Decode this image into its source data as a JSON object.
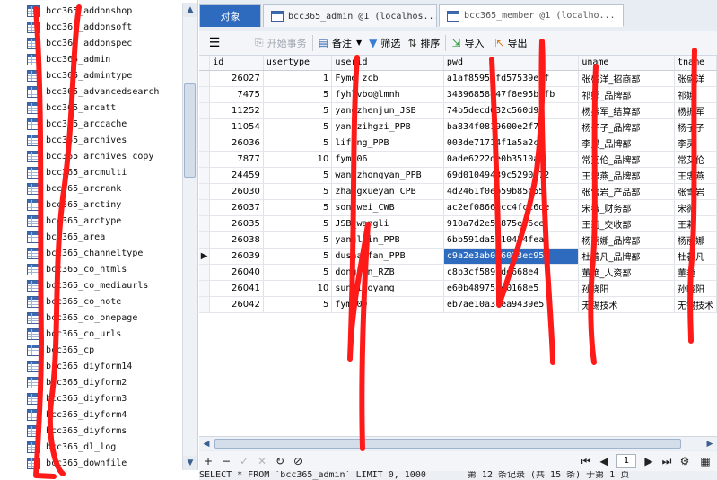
{
  "tree": {
    "items": [
      "bcc365_addonshop",
      "bcc365_addonsoft",
      "bcc365_addonspec",
      "bcc365_admin",
      "bcc365_admintype",
      "bcc365_advancedsearch",
      "bcc365_arcatt",
      "bcc365_arccache",
      "bcc365_archives",
      "bcc365_archives_copy",
      "bcc365_arcmulti",
      "bcc365_arcrank",
      "bcc365_arctiny",
      "bcc365_arctype",
      "bcc365_area",
      "bcc365_channeltype",
      "bcc365_co_htmls",
      "bcc365_co_mediaurls",
      "bcc365_co_note",
      "bcc365_co_onepage",
      "bcc365_co_urls",
      "bcc365_cp",
      "bcc365_diyform14",
      "bcc365_diyform2",
      "bcc365_diyform3",
      "bcc365_diyform4",
      "bcc365_diyforms",
      "bcc365_dl_log",
      "bcc365_downfile"
    ]
  },
  "tabs": {
    "objects": "对象",
    "admin": "bcc365_admin @1 (localhos...",
    "member": "bcc365_member @1 (localho..."
  },
  "toolbar": {
    "menu_icon": "menu-icon",
    "begin_tx": "开始事务",
    "note": "备注",
    "filter": "筛选",
    "sort": "排序",
    "import": "导入",
    "export": "导出"
  },
  "grid": {
    "columns": [
      "id",
      "usertype",
      "userid",
      "pwd",
      "uname",
      "tname"
    ],
    "selected_row": 12,
    "rows": [
      [
        "26027",
        "1",
        "Fyme_zcb",
        "a1af8595ffd57539e3f",
        "张盛洋_招商部",
        "张盛洋"
      ],
      [
        "7475",
        "5",
        "fyhlvbo@lmnh",
        "34396858847f8e95b5fb",
        "祁娜_品牌部",
        "祁娜"
      ],
      [
        "11252",
        "5",
        "yangzhenjun_JSB",
        "74b5decd032c560d9e",
        "杨振军_结算部",
        "杨振军"
      ],
      [
        "11054",
        "5",
        "yangzihgzi_PPB",
        "ba834f0819600e2f7b",
        "杨子子_品牌部",
        "杨子子"
      ],
      [
        "26036",
        "5",
        "lifeng_PPB",
        "003de71714f1a5a2ca",
        "李灵_品牌部",
        "李灵"
      ],
      [
        "7877",
        "10",
        "fym006",
        "0ade6222de0b3510a5",
        "常艾伦_品牌部",
        "常艾伦"
      ],
      [
        "24459",
        "5",
        "wangzhongyan_PPB",
        "69d01049439c5290a72",
        "王忠燕_品牌部",
        "王忠燕"
      ],
      [
        "26030",
        "5",
        "zhangxueyan_CPB",
        "4d2461f0eb59b85d55",
        "张雪岩_产品部",
        "张雪岩"
      ],
      [
        "26037",
        "5",
        "songwei_CWB",
        "ac2ef0866ecc4fcc6de",
        "宋薇_财务部",
        "宋薇"
      ],
      [
        "26035",
        "5",
        "JSB_wangli",
        "910a7d2e52875ed6ce",
        "王莉_交收部",
        "王莉"
      ],
      [
        "26038",
        "5",
        "yangliin_PPB",
        "6bb591da5110454fea",
        "杨丽娜_品牌部",
        "杨丽娜"
      ],
      [
        "26039",
        "5",
        "dushanfan_PPB",
        "c9a2e3ab046023ec954",
        "杜善凡_品牌部",
        "杜善凡"
      ],
      [
        "26040",
        "5",
        "dongyan_RZB",
        "c8b3cf5893de668e4",
        "董艳_人资部",
        "董艳"
      ],
      [
        "26041",
        "10",
        "sunxiaoyang",
        "e60b489758e0168e5",
        "孙晓阳",
        "孙晓阳"
      ],
      [
        "26042",
        "5",
        "fym000",
        "eb7ae10a3fea9439e5",
        "无锡技术",
        "无锡技术"
      ]
    ]
  },
  "navbar": {
    "page": "1"
  },
  "status": {
    "sql": "SELECT * FROM `bcc365_admin` LIMIT 0, 1000",
    "info": "第 12 条记录 (共 15 条) 于第 1 页"
  },
  "colors": {
    "accent": "#2e6bbf",
    "stroke": "#ff1a1a"
  }
}
